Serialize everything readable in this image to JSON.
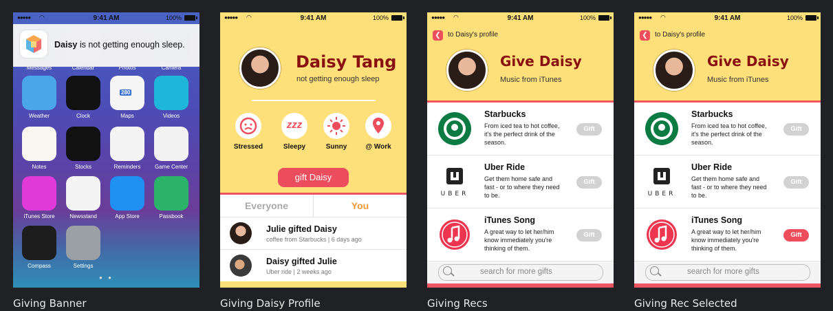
{
  "status": {
    "time": "9:41 AM",
    "battery": "100%"
  },
  "screens": [
    {
      "caption": "Giving Banner"
    },
    {
      "caption": "Giving Daisy Profile"
    },
    {
      "caption": "Giving Recs"
    },
    {
      "caption": "Giving Rec Selected"
    }
  ],
  "banner": {
    "name": "Daisy",
    "message": " is not getting enough sleep."
  },
  "home_apps": [
    {
      "label": "Messages"
    },
    {
      "label": "Calendar"
    },
    {
      "label": "Photos"
    },
    {
      "label": "Camera"
    },
    {
      "label": "Weather"
    },
    {
      "label": "Clock"
    },
    {
      "label": "Maps"
    },
    {
      "label": "Videos"
    },
    {
      "label": "Notes"
    },
    {
      "label": "Stocks"
    },
    {
      "label": "Reminders"
    },
    {
      "label": "Game Center"
    },
    {
      "label": "iTunes Store"
    },
    {
      "label": "Newsstand"
    },
    {
      "label": "App Store"
    },
    {
      "label": "Passbook"
    },
    {
      "label": "Compass"
    },
    {
      "label": "Settings"
    }
  ],
  "maps_badge": "280",
  "profile": {
    "name": "Daisy Tang",
    "status": "not getting enough sleep",
    "moods": [
      {
        "label": "Stressed",
        "icon": "stressed-face-icon"
      },
      {
        "label": "Sleepy",
        "icon": "sleepy-zzz-icon"
      },
      {
        "label": "Sunny",
        "icon": "sun-icon"
      },
      {
        "label": "@ Work",
        "icon": "location-pin-icon"
      }
    ],
    "zzz": "zzz",
    "gift_button": "gift Daisy",
    "tabs": [
      "Everyone",
      "You"
    ],
    "feed": [
      {
        "title": "Julie gifted Daisy",
        "sub": "coffee from Starbucks | 6 days ago"
      },
      {
        "title": "Daisy gifted Julie",
        "sub": "Uber ride | 2 weeks ago"
      }
    ]
  },
  "recs": {
    "back_label": "to Daisy's profile",
    "title": "Give Daisy",
    "subtitle": "Music from iTunes",
    "items": [
      {
        "title": "Starbucks",
        "desc": "From iced tea to hot coffee, it's the perfect drink of the season.",
        "logo": "starbucks-logo",
        "logo_text": "STARBUCKS COFFEE"
      },
      {
        "title": "Uber Ride",
        "desc": "Get them home safe and fast - or to where they need to be.",
        "logo": "uber-logo",
        "logo_text": "UBER"
      },
      {
        "title": "iTunes Song",
        "desc": "A great way to let her/him know immediately you're thinking of them.",
        "logo": "itunes-logo"
      }
    ],
    "gift_label": "Gift",
    "search_placeholder": "search for more gifts"
  },
  "colors": {
    "accent": "#ee4d5b",
    "yellow": "#fde07a",
    "name_red": "#8a1010"
  }
}
